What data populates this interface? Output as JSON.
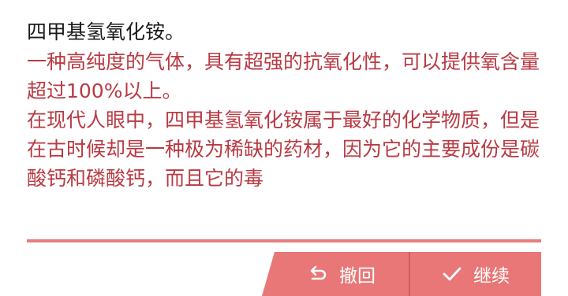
{
  "content": {
    "title": "四甲基氢氧化铵。",
    "paragraph_1": "一种高纯度的气体，具有超强的抗氧化性，可以提供氧含量超过100%以上。",
    "paragraph_2": "在现代人眼中，四甲基氢氧化铵属于最好的化学物质，但是在古时候却是一种极为稀缺的药材，因为它的主要成份是碳酸钙和磷酸钙，而且它的毒"
  },
  "actions": {
    "undo_label": "撤回",
    "continue_label": "继续"
  },
  "icons": {
    "undo": "undo-arrow-icon",
    "continue": "checkmark-icon"
  },
  "colors": {
    "accent": "#e97777",
    "body_text": "#b83a43",
    "title_text": "#1a1a1a",
    "divider": "#e87d7d"
  }
}
